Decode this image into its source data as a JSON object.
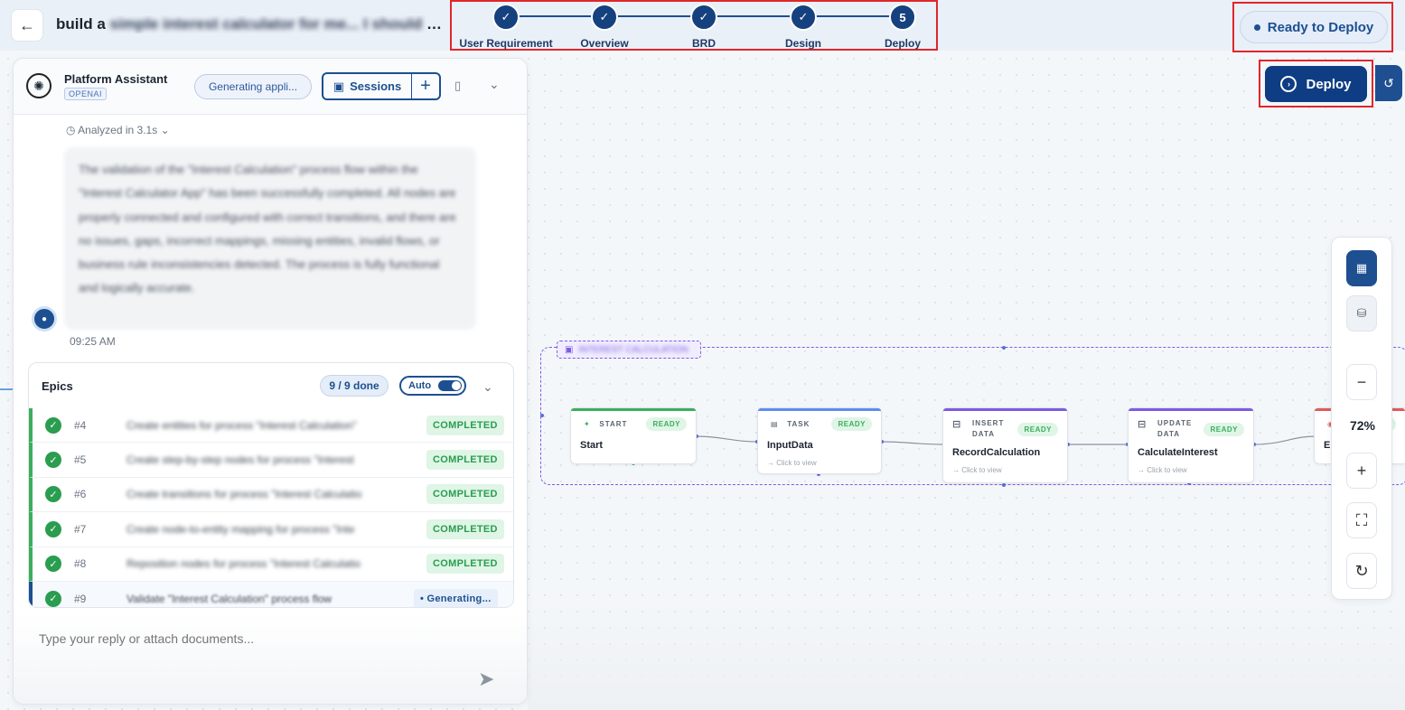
{
  "header": {
    "back_icon": "arrow-left-icon",
    "title_visible": "build a",
    "title_blurred": "simple interest calculator for me... I should be a",
    "title_suffix": "...",
    "status_label": "Ready to Deploy",
    "deploy_label": "Deploy"
  },
  "stepper": {
    "steps": [
      {
        "label": "User Requirement",
        "state": "done",
        "mark": "✓"
      },
      {
        "label": "Overview",
        "state": "done",
        "mark": "✓"
      },
      {
        "label": "BRD",
        "state": "done",
        "mark": "✓"
      },
      {
        "label": "Design",
        "state": "done",
        "mark": "✓"
      },
      {
        "label": "Deploy",
        "state": "current",
        "mark": "5"
      }
    ]
  },
  "assistant": {
    "name": "Platform Assistant",
    "provider": "OPENAI",
    "generating_label": "Generating appli...",
    "sessions_label": "Sessions",
    "analyzed_label": "Analyzed in 3.1s",
    "message": "The validation of the \"Interest Calculation\" process flow within the \"Interest Calculator App\" has been successfully completed. All nodes are properly connected and configured with correct transitions, and there are no issues, gaps, incorrect mappings, missing entities, invalid flows, or business rule inconsistencies detected. The process is fully functional and logically accurate.",
    "message_time": "09:25 AM"
  },
  "epics": {
    "title": "Epics",
    "done_label": "9 / 9 done",
    "auto_label": "Auto",
    "items": [
      {
        "id": "#4",
        "text": "Create entities for process \"Interest Calculation\"",
        "status": "COMPLETED"
      },
      {
        "id": "#5",
        "text": "Create step-by-step nodes for process \"Interest",
        "status": "COMPLETED"
      },
      {
        "id": "#6",
        "text": "Create transitions for process \"Interest Calculatio",
        "status": "COMPLETED"
      },
      {
        "id": "#7",
        "text": "Create node-to-entity mapping for process \"Inte",
        "status": "COMPLETED"
      },
      {
        "id": "#8",
        "text": "Reposition nodes for process \"Interest Calculatio",
        "status": "COMPLETED"
      },
      {
        "id": "#9",
        "text": "Validate \"Interest Calculation\" process flow",
        "status": "• Generating..."
      }
    ]
  },
  "reply": {
    "placeholder": "Type your reply or attach documents..."
  },
  "flow": {
    "group_label": "INTEREST CALCULATION",
    "nodes": [
      {
        "type": "START",
        "type2": "",
        "ready": "READY",
        "name": "Start",
        "hint": "",
        "color": "#3cae5e",
        "icon": "✦"
      },
      {
        "type": "TASK",
        "type2": "",
        "ready": "READY",
        "name": "InputData",
        "hint": "→ Click to view",
        "color": "#5b8def",
        "icon": "▤"
      },
      {
        "type": "INSERT",
        "type2": "DATA",
        "ready": "READY",
        "name": "RecordCalculation",
        "hint": "→ Click to view",
        "color": "#7c5ce0",
        "icon": "⊟"
      },
      {
        "type": "UPDATE",
        "type2": "DATA",
        "ready": "READY",
        "name": "CalculateInterest",
        "hint": "→ Click to view",
        "color": "#7c5ce0",
        "icon": "⊟"
      },
      {
        "type": "",
        "type2": "",
        "ready": "RE",
        "name": "E",
        "hint": "",
        "color": "#e05c5c",
        "icon": "◉"
      }
    ]
  },
  "zoom": {
    "value": "72%"
  }
}
